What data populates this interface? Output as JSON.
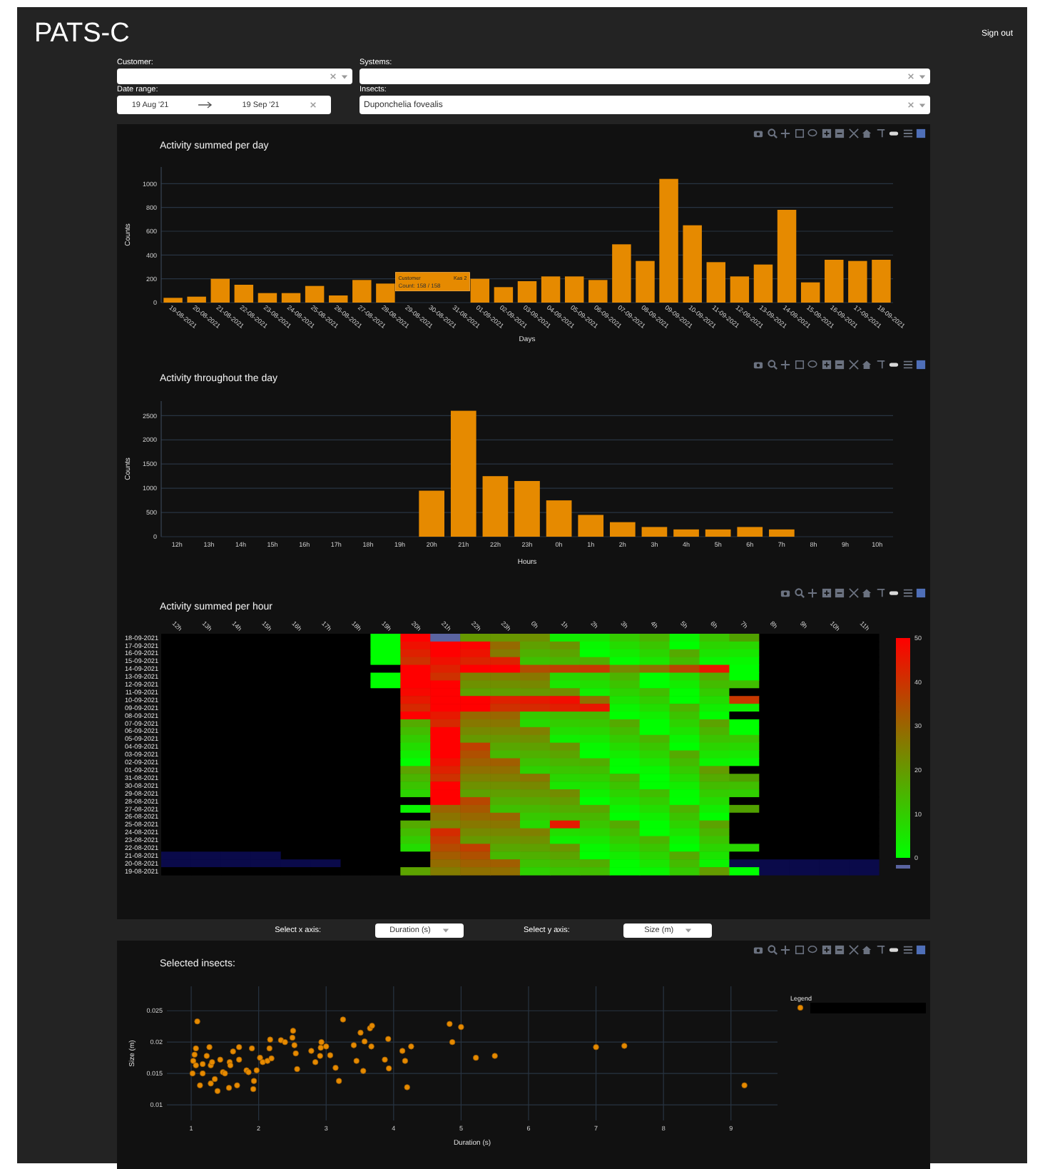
{
  "header": {
    "title": "PATS-C",
    "sign_out": "Sign out"
  },
  "filters": {
    "customer": {
      "label": "Customer:"
    },
    "systems": {
      "label": "Systems:"
    },
    "date_range": {
      "label": "Date range:",
      "start": "19 Aug '21",
      "end": "19 Sep '21"
    },
    "insects": {
      "label": "Insects:",
      "value": "Duponchelia fovealis"
    }
  },
  "day_chart": {
    "chart_data": {
      "type": "bar",
      "grid": true,
      "title": "Activity summed per day",
      "xlabel": "Days",
      "ylabel": "Counts",
      "ylim": [
        0,
        1140
      ],
      "yticks": [
        0,
        200,
        400,
        600,
        800,
        1000
      ],
      "categories": [
        "19-08-2021",
        "20-08-2021",
        "21-08-2021",
        "22-08-2021",
        "23-08-2021",
        "24-08-2021",
        "25-08-2021",
        "26-08-2021",
        "27-08-2021",
        "28-08-2021",
        "29-08-2021",
        "30-08-2021",
        "31-08-2021",
        "01-09-2021",
        "02-09-2021",
        "03-09-2021",
        "04-09-2021",
        "05-09-2021",
        "06-09-2021",
        "07-09-2021",
        "08-09-2021",
        "09-09-2021",
        "10-09-2021",
        "11-09-2021",
        "12-09-2021",
        "13-09-2021",
        "14-09-2021",
        "15-09-2021",
        "16-09-2021",
        "17-09-2021",
        "18-09-2021"
      ],
      "series": [
        {
          "color": "#e68a00",
          "values": [
            40,
            50,
            200,
            150,
            80,
            80,
            140,
            60,
            190,
            160,
            null,
            null,
            null,
            200,
            130,
            180,
            220,
            220,
            190,
            490,
            350,
            1040,
            650,
            340,
            220,
            320,
            780,
            170,
            360,
            350,
            360
          ]
        }
      ]
    },
    "tooltip": {
      "title": "Customer",
      "trace": "Kas 2",
      "text": "Count: 158 / 158"
    }
  },
  "hour_chart": {
    "chart_data": {
      "type": "bar",
      "grid": true,
      "title": "Activity throughout the day",
      "xlabel": "Hours",
      "ylabel": "Counts",
      "ylim": [
        0,
        2800
      ],
      "yticks": [
        0,
        500,
        1000,
        1500,
        2000,
        2500
      ],
      "categories": [
        "12h",
        "13h",
        "14h",
        "15h",
        "16h",
        "17h",
        "18h",
        "19h",
        "20h",
        "21h",
        "22h",
        "23h",
        "0h",
        "1h",
        "2h",
        "3h",
        "4h",
        "5h",
        "6h",
        "7h",
        "8h",
        "9h",
        "10h"
      ],
      "series": [
        {
          "color": "#e68a00",
          "values": [
            0,
            0,
            0,
            0,
            0,
            0,
            0,
            0,
            950,
            2600,
            1250,
            1150,
            750,
            450,
            300,
            200,
            150,
            150,
            200,
            150,
            0,
            0,
            0
          ]
        }
      ]
    }
  },
  "heatmap": {
    "title": "Activity summed per hour",
    "columns": [
      "12h",
      "13h",
      "14h",
      "15h",
      "16h",
      "17h",
      "18h",
      "19h",
      "20h",
      "21h",
      "22h",
      "23h",
      "0h",
      "1h",
      "2h",
      "3h",
      "4h",
      "5h",
      "6h",
      "7h",
      "8h",
      "9h",
      "10h",
      "11h"
    ],
    "rows": [
      "18-09-2021",
      "17-09-2021",
      "16-09-2021",
      "15-09-2021",
      "14-09-2021",
      "13-09-2021",
      "12-09-2021",
      "11-09-2021",
      "10-09-2021",
      "09-09-2021",
      "08-09-2021",
      "07-09-2021",
      "06-09-2021",
      "05-09-2021",
      "04-09-2021",
      "03-09-2021",
      "02-09-2021",
      "01-09-2021",
      "31-08-2021",
      "30-08-2021",
      "29-08-2021",
      "28-08-2021",
      "27-08-2021",
      "26-08-2021",
      "25-08-2021",
      "24-08-2021",
      "23-08-2021",
      "22-08-2021",
      "21-08-2021",
      "20-08-2021",
      "19-08-2021"
    ],
    "colorbar_ticks": [
      "50",
      "40",
      "30",
      "20",
      "10",
      "0"
    ]
  },
  "axis_selectors": {
    "x": {
      "label": "Select x axis:",
      "value": "Duration (s)"
    },
    "y": {
      "label": "Select y axis:",
      "value": "Size (m)"
    }
  },
  "scatter": {
    "legend_title": "Legend",
    "chart_data": {
      "type": "scatter",
      "grid": true,
      "title": "Selected insects:",
      "xlabel": "Duration (s)",
      "ylabel": "Size (m)",
      "xlim": [
        0.64,
        9.69
      ],
      "ylim": [
        0.0075,
        0.0289
      ],
      "xticks": [
        1,
        2,
        3,
        4,
        5,
        6,
        7,
        8,
        9
      ],
      "yticks": [
        0.01,
        0.015,
        0.02,
        0.025
      ],
      "x": [
        1.02,
        1.03,
        1.05,
        1.07,
        1.07,
        1.09,
        1.13,
        1.17,
        1.17,
        1.23,
        1.27,
        1.29,
        1.31,
        1.29,
        1.35,
        1.39,
        1.43,
        1.47,
        1.5,
        1.56,
        1.57,
        1.58,
        1.62,
        1.68,
        1.71,
        1.71,
        1.82,
        1.85,
        1.9,
        1.92,
        1.93,
        1.97,
        2.02,
        2.06,
        2.13,
        2.16,
        2.17,
        2.19,
        2.33,
        2.39,
        2.5,
        2.51,
        2.53,
        2.55,
        2.57,
        2.78,
        2.84,
        2.91,
        2.92,
        2.93,
        3.0,
        3.06,
        3.14,
        3.19,
        3.25,
        3.41,
        3.45,
        3.51,
        3.57,
        3.55,
        3.65,
        3.68,
        3.67,
        3.87,
        3.92,
        3.93,
        4.13,
        4.17,
        4.2,
        4.26,
        4.83,
        4.87,
        5.0,
        5.22,
        5.5,
        7.0,
        7.42,
        9.2
      ],
      "series": [
        {
          "color": "#e68a00",
          "values": [
            0.015,
            0.017,
            0.018,
            0.019,
            0.0163,
            0.0233,
            0.0131,
            0.015,
            0.0165,
            0.0178,
            0.0192,
            0.0163,
            0.0168,
            0.0134,
            0.0141,
            0.0122,
            0.0172,
            0.0152,
            0.015,
            0.0127,
            0.0168,
            0.0163,
            0.0185,
            0.0131,
            0.0192,
            0.0172,
            0.0155,
            0.0152,
            0.019,
            0.0125,
            0.0138,
            0.0155,
            0.0175,
            0.0168,
            0.017,
            0.019,
            0.0204,
            0.0174,
            0.0203,
            0.02,
            0.0207,
            0.0218,
            0.0195,
            0.0182,
            0.0157,
            0.0186,
            0.0168,
            0.0178,
            0.0191,
            0.02,
            0.0193,
            0.0179,
            0.0159,
            0.0138,
            0.0236,
            0.0195,
            0.017,
            0.0215,
            0.0201,
            0.0154,
            0.0222,
            0.0226,
            0.0193,
            0.0172,
            0.0205,
            0.0158,
            0.0186,
            0.017,
            0.0128,
            0.0193,
            0.0229,
            0.02,
            0.0224,
            0.0175,
            0.0178,
            0.0192,
            0.0194,
            0.0131
          ]
        }
      ]
    }
  }
}
